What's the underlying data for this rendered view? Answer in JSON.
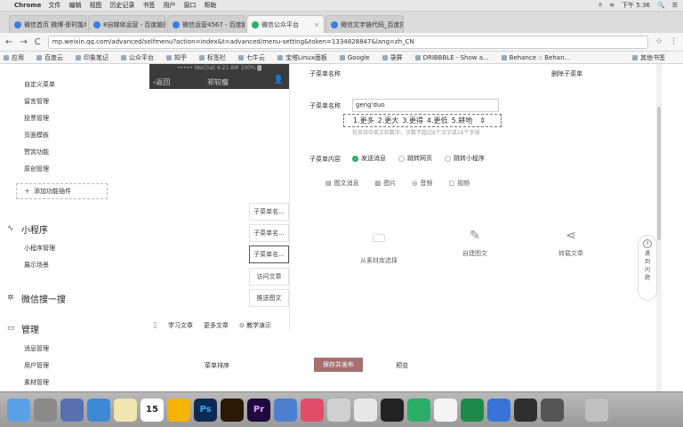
{
  "menubar": {
    "apple": "",
    "app": "Chrome",
    "items": [
      "文件",
      "编辑",
      "视图",
      "历史记录",
      "书签",
      "用户",
      "窗口",
      "帮助"
    ],
    "right_status": [
      "⌾",
      "≋",
      "🔍",
      "☰"
    ],
    "clock": "下午 5:36"
  },
  "tabs": [
    {
      "label": "微信首页 微博·即时能地",
      "active": false
    },
    {
      "label": "8自媒体运营 - 百度脑图",
      "active": false
    },
    {
      "label": "微信运营4567 - 百度脑图",
      "active": false
    },
    {
      "label": "微信公众平台",
      "active": true
    },
    {
      "label": "微信文字链代码_百度搜索",
      "active": false
    }
  ],
  "address": {
    "back": "←",
    "forward": "→",
    "reload": "C",
    "url": "mp.weixin.qq.com/advanced/selfmenu?action=index&t=advanced/menu-setting&token=1334828847&lang=zh_CN"
  },
  "bookmarks": [
    "应用",
    "百度云",
    "印象笔记",
    "公众平台",
    "知乎",
    "标签栏",
    "七牛云",
    "宝塔Linux面板",
    "Google",
    "录屏",
    "DRIBBBLE - Show a...",
    "Behance :: Behan..."
  ],
  "bookmarks_right": "其他书签",
  "sidebar": {
    "top_items": [
      "自定义菜单",
      "留言管理",
      "投票管理",
      "页面模板",
      "赞赏功能",
      "原创管理"
    ],
    "add_plugin": "添加功能插件",
    "section_miniprogram": {
      "title": "小程序",
      "items": [
        "小程序管理",
        "展示场景"
      ]
    },
    "section_search": {
      "title": "微信搜一搜"
    },
    "section_manage": {
      "title": "管理",
      "items": [
        "消息管理",
        "用户管理",
        "素材管理"
      ]
    }
  },
  "phone": {
    "status": "••••• WeChat  4:21 AM  100% ▇",
    "back": "返回",
    "title": "祁较瘦"
  },
  "submenus": [
    "子菜单名...",
    "子菜单名...",
    "子菜单名...",
    "访问文章",
    "推送图文"
  ],
  "content": {
    "submenu_name_label": "子菜单名称",
    "delete_submenu": "删除子菜单",
    "name_field_label": "子菜单名称",
    "name_value": "geng'duo",
    "ime_candidates": [
      "1.更多",
      "2.更大",
      "3.更得",
      "4.更低",
      "5.耕地"
    ],
    "hint": "仅支持中英文和数字，字数不超过8个汉字或16个字母",
    "content_label": "子菜单内容",
    "radio_options": [
      {
        "label": "发送消息",
        "checked": true
      },
      {
        "label": "跳转网页",
        "checked": false
      },
      {
        "label": "跳转小程序",
        "checked": false
      }
    ],
    "media_tabs": [
      "图文消息",
      "图片",
      "音频",
      "视频"
    ],
    "media_options": [
      "从素材库选择",
      "自建图文",
      "转载文章"
    ]
  },
  "bottom_links": [
    "学习文章",
    "更多文章",
    "教学演示"
  ],
  "footer": {
    "sort": "菜单排序",
    "save": "保存并发布",
    "preview": "预览"
  },
  "feedback": {
    "icon": "?",
    "label": "遇到问题"
  },
  "dock_apps": [
    "Finder",
    "Launchpad",
    "Rocket",
    "Safari",
    "Notes",
    "Calendar",
    "Sketch",
    "Ps",
    "Ai",
    "Pr",
    "Keynote",
    "Music",
    "WeChat",
    "Mail",
    "QQ",
    "Messages",
    "Note",
    "Sublime",
    "Chrome",
    "Trash"
  ],
  "calendar_day": "15"
}
